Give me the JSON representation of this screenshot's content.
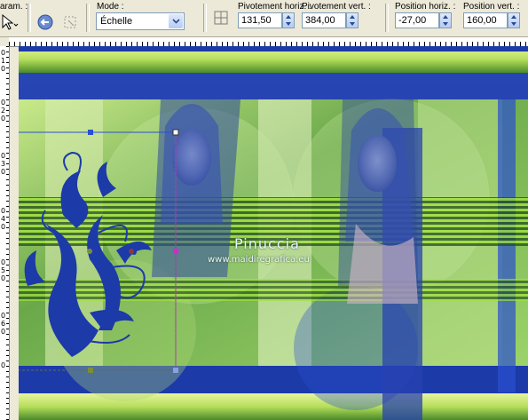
{
  "toolbar": {
    "param_label": "aram. :",
    "mode": {
      "label": "Mode :",
      "value": "Échelle"
    },
    "pivot_h": {
      "label": "Pivotement horiz. :",
      "value": "131,50"
    },
    "pivot_v": {
      "label": "Pivotement vert. :",
      "value": "384,00"
    },
    "pos_h": {
      "label": "Position horiz. :",
      "value": "-27,00"
    },
    "pos_v": {
      "label": "Position vert. :",
      "value": "160,00"
    }
  },
  "ruler_left_digits": [
    "0",
    "1",
    "0",
    "0",
    "2",
    "0",
    "0",
    "3",
    "0",
    "0",
    "4",
    "0",
    "0",
    "5",
    "0",
    "0",
    "6",
    "0",
    "0"
  ],
  "canvas": {
    "watermark_title": "Pinuccia",
    "watermark_url": "www.maidiregrafica.eu"
  },
  "colors": {
    "deep_blue": "#1c3aa8",
    "lime": "#9fe23a",
    "handle_blue": "#2a4fd0",
    "handle_magenta": "#d02ad0"
  }
}
